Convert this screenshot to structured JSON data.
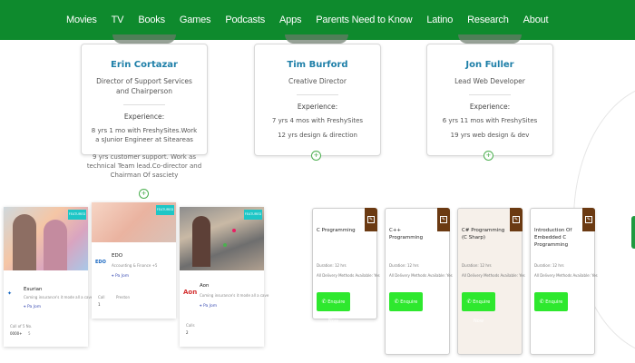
{
  "nav": {
    "items": [
      "Movies",
      "TV",
      "Books",
      "Games",
      "Podcasts",
      "Apps",
      "Parents Need to Know",
      "Latino",
      "Research",
      "About"
    ]
  },
  "team": [
    {
      "name": "Erin Cortazar",
      "title": "Director of Support Services and Chairperson",
      "experience_label": "Experience:",
      "lines": [
        "8 yrs 1 mo with FreshySites.Work a sJunior Engineer at Siteareas"
      ],
      "overflow": "9 yrs customer support. Work as technical Team lead.Co-director and Chairman Of sasciety"
    },
    {
      "name": "Tim Burford",
      "title": "Creative Director",
      "experience_label": "Experience:",
      "lines": [
        "7 yrs 4 mos with FreshySites",
        "12 yrs design & direction"
      ]
    },
    {
      "name": "Jon Fuller",
      "title": "Lead Web Developer",
      "experience_label": "Experience:",
      "lines": [
        "6 yrs 11 mos with FreshySites",
        "19 yrs web design & dev"
      ]
    }
  ],
  "insurance_cards": [
    {
      "badge": "FEATURED",
      "logo": "Esurance",
      "name": "Esurian",
      "desc": "Coming insurance's it mode all a cave +5",
      "pin": "Pa Jom",
      "stat_label": "Call of 5 No.",
      "stat_value": "0000+",
      "stat2": "5"
    },
    {
      "badge": "FEATURED",
      "logo": "EDO",
      "name": "EDO",
      "desc": "Accounting & Finance +5",
      "pin": "Pa Jom",
      "stat_label": "Call",
      "stat_value": "1",
      "stat2": "Preston"
    },
    {
      "badge": "FEATURED",
      "logo": "Aon",
      "name": "Aon",
      "desc": "Coming insurance's it mode all a cave",
      "pin": "Pa Jom",
      "stat_label": "Calls",
      "stat_value": "2",
      "stat2": ""
    }
  ],
  "courses": [
    {
      "title": "C Programming",
      "duration": "Duration: 12 hrs",
      "delivery": "All Delivery Methods Available: Yes",
      "button": "Enquire Now"
    },
    {
      "title": "C++ Programming",
      "duration": "Duration: 12 hrs",
      "delivery": "All Delivery Methods Available: Yes",
      "button": "Enquire Now"
    },
    {
      "title": "C# Programming (C Sharp)",
      "duration": "Duration: 12 hrs",
      "delivery": "All Delivery Methods Available: Yes",
      "button": "Enquire Now"
    },
    {
      "title": "Introduction Of Embedded C Programming",
      "duration": "Duration: 12 hrs",
      "delivery": "All Delivery Methods Available: Yes",
      "button": "Enquire Now"
    }
  ],
  "colors": {
    "nav_bg": "#0e8a2d",
    "name_blue": "#1e7fa8",
    "badge_teal": "#1ec6c6",
    "course_tab": "#6b3a12",
    "button_green": "#2ee82e"
  }
}
